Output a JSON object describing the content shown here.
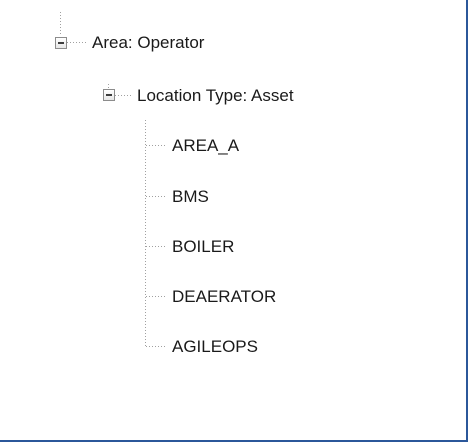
{
  "tree": {
    "root": {
      "label": "Area: Operator",
      "expander_icon": "collapse-minus-icon",
      "child": {
        "label": "Location Type: Asset",
        "expander_icon": "collapse-minus-icon",
        "items": [
          {
            "label": "AREA_A"
          },
          {
            "label": "BMS"
          },
          {
            "label": "BOILER"
          },
          {
            "label": "DEAERATOR"
          },
          {
            "label": "AGILEOPS"
          }
        ]
      }
    }
  },
  "colors": {
    "border": "#2b579a",
    "connector": "#a0a0a0",
    "text": "#1a1a1a"
  }
}
